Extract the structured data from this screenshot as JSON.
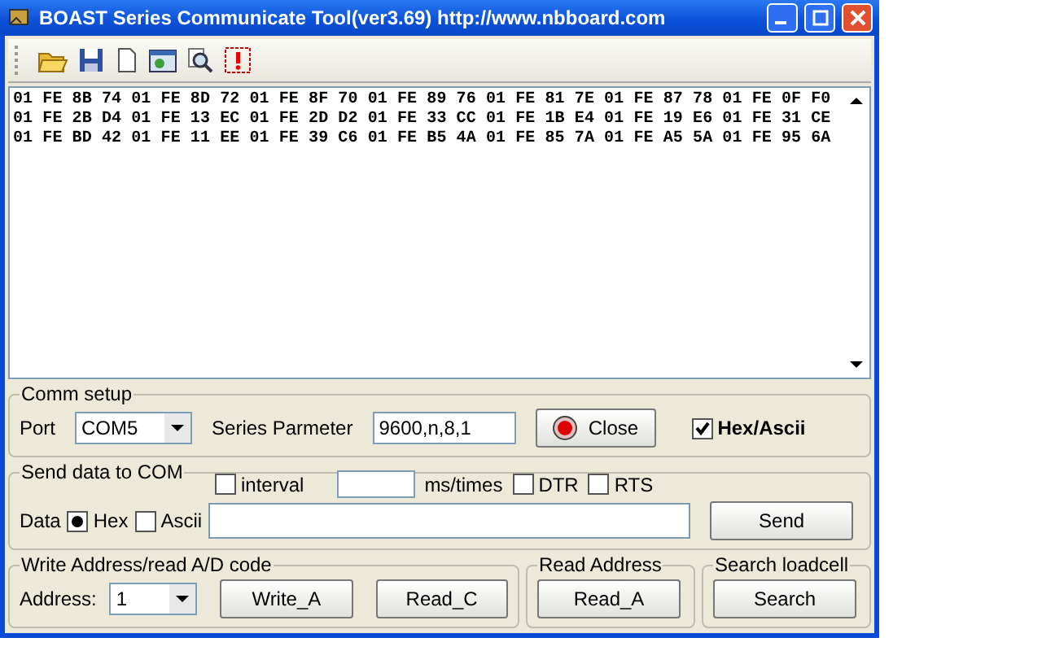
{
  "window": {
    "title": "BOAST Series Communicate Tool(ver3.69) http://www.nbboard.com"
  },
  "received_lines": [
    "01 FE 8B 74 01 FE 8D 72 01 FE 8F 70 01 FE 89 76 01 FE 81 7E 01 FE 87 78 01 FE 0F F0",
    "01 FE 2B D4 01 FE 13 EC 01 FE 2D D2 01 FE 33 CC 01 FE 1B E4 01 FE 19 E6 01 FE 31 CE",
    "01 FE BD 42 01 FE 11 EE 01 FE 39 C6 01 FE B5 4A 01 FE 85 7A 01 FE A5 5A 01 FE 95 6A"
  ],
  "comm_setup": {
    "title": "Comm setup",
    "port_label": "Port",
    "port_value": "COM5",
    "param_label": "Series Parmeter",
    "param_value": "9600,n,8,1",
    "close_button": "Close",
    "hex_ascii": {
      "label": "Hex/Ascii",
      "checked": true
    }
  },
  "send_data": {
    "title": "Send data to COM",
    "interval": {
      "label": "interval",
      "checked": false
    },
    "interval_value_unit": "ms/times",
    "dtr": {
      "label": "DTR",
      "checked": false
    },
    "rts": {
      "label": "RTS",
      "checked": false
    },
    "data_label": "Data",
    "hex": {
      "label": "Hex",
      "selected": true
    },
    "ascii": {
      "label": "Ascii",
      "checked": false
    },
    "send_button": "Send"
  },
  "write_address": {
    "title": "Write Address/read A/D code",
    "address_label": "Address:",
    "address_value": "1",
    "buttons": [
      "Write_A",
      "Read_C"
    ]
  },
  "read_address": {
    "title": "Read Address",
    "button": "Read_A"
  },
  "search_loadcell": {
    "title": "Search loadcell",
    "button": "Search"
  }
}
